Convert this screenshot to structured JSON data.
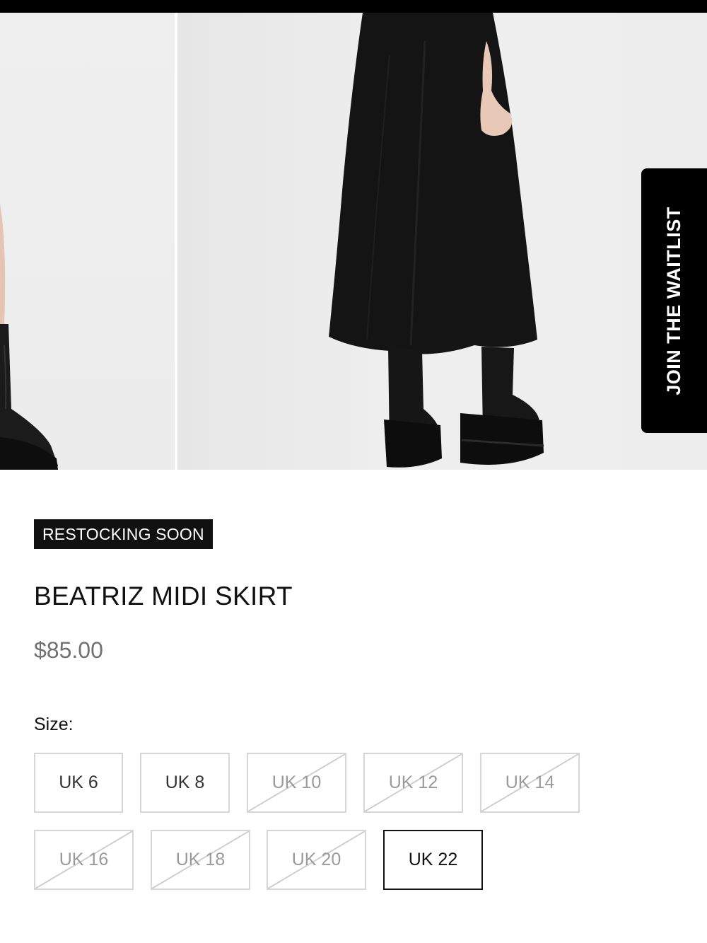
{
  "product": {
    "badge": "RESTOCKING SOON",
    "title": "BEATRIZ MIDI SKIRT",
    "price": "$85.00"
  },
  "waitlist": {
    "label": "JOIN THE WAITLIST"
  },
  "sizes": {
    "label": "Size:",
    "options": [
      {
        "label": "UK 6",
        "available": true,
        "selected": false
      },
      {
        "label": "UK 8",
        "available": true,
        "selected": false
      },
      {
        "label": "UK 10",
        "available": false,
        "selected": false
      },
      {
        "label": "UK 12",
        "available": false,
        "selected": false
      },
      {
        "label": "UK 14",
        "available": false,
        "selected": false
      },
      {
        "label": "UK 16",
        "available": false,
        "selected": false
      },
      {
        "label": "UK 18",
        "available": false,
        "selected": false
      },
      {
        "label": "UK 20",
        "available": false,
        "selected": false
      },
      {
        "label": "UK 22",
        "available": true,
        "selected": true
      }
    ]
  }
}
